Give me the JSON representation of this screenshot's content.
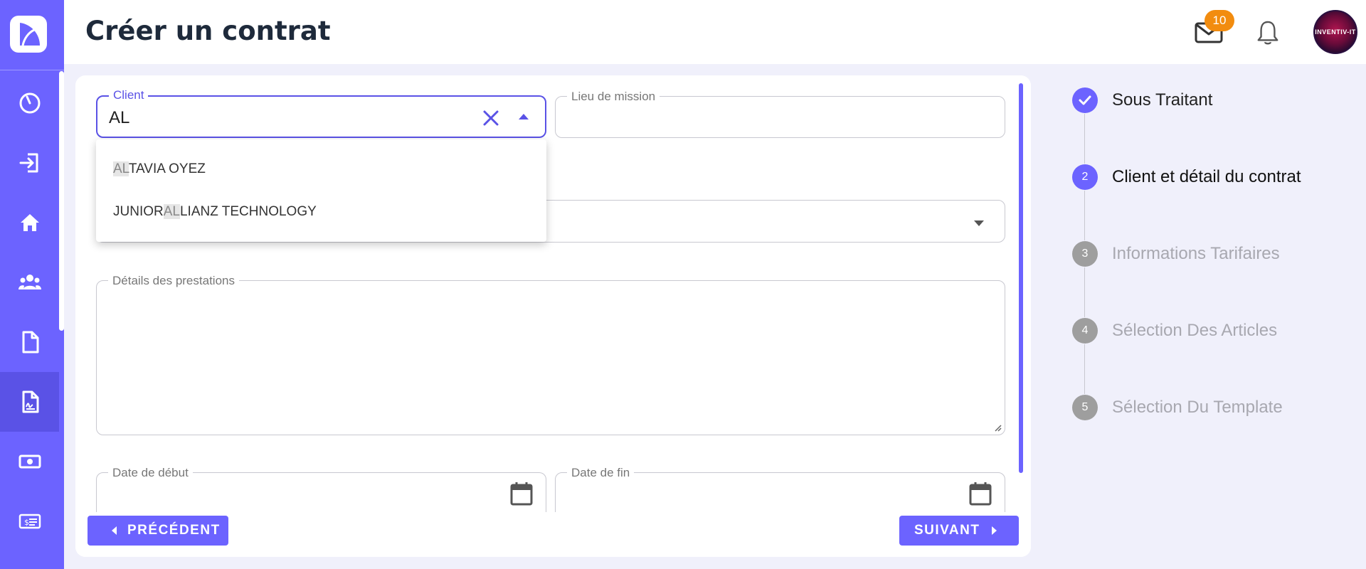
{
  "header": {
    "title": "Créer un contrat",
    "notifications_count": "10",
    "avatar_text": "INVENTIV-IT"
  },
  "sidebar": {
    "items": [
      {
        "icon": "dashboard-gauge-icon"
      },
      {
        "icon": "login-icon"
      },
      {
        "icon": "home-icon"
      },
      {
        "icon": "users-group-icon"
      },
      {
        "icon": "document-icon"
      },
      {
        "icon": "contract-signature-icon",
        "active": true
      },
      {
        "icon": "money-icon"
      },
      {
        "icon": "invoice-icon"
      }
    ]
  },
  "form": {
    "client": {
      "label": "Client",
      "value": "AL"
    },
    "lieu_de_mission": {
      "label": "Lieu de mission",
      "value": ""
    },
    "details_prestations": {
      "label": "Détails des prestations",
      "value": ""
    },
    "date_debut": {
      "label": "Date de début",
      "value": ""
    },
    "date_fin": {
      "label": "Date de fin",
      "value": ""
    },
    "client_options": [
      {
        "before": "",
        "match": "AL",
        "after": "TAVIA OYEZ"
      },
      {
        "before": "JUNIOR",
        "match": "AL",
        "after": "LIANZ TECHNOLOGY"
      }
    ],
    "prev_label": "PRÉCÉDENT",
    "next_label": "SUIVANT"
  },
  "stepper": {
    "steps": [
      {
        "number": "1",
        "label": "Sous Traitant",
        "state": "completed"
      },
      {
        "number": "2",
        "label": "Client et détail du contrat",
        "state": "active"
      },
      {
        "number": "3",
        "label": "Informations Tarifaires",
        "state": "inactive"
      },
      {
        "number": "4",
        "label": "Sélection Des Articles",
        "state": "inactive"
      },
      {
        "number": "5",
        "label": "Sélection Du Template",
        "state": "inactive"
      }
    ]
  },
  "colors": {
    "primary": "#6c63ff",
    "primary_dark": "#5a52e6",
    "badge": "#f28c0f",
    "background": "#f0f0fb",
    "step_inactive": "#9e9e9e"
  }
}
